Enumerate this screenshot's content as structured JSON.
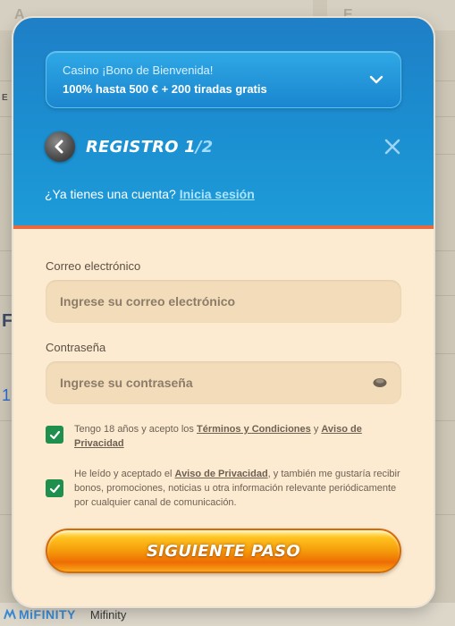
{
  "background": {
    "title_fragment_1": "A",
    "title_fragment_2": "E",
    "letter_1": "F",
    "letter_2": "1",
    "letter_3": "E",
    "footer_brand_logo": "MiFINITY",
    "footer_brand_name": "Mifinity"
  },
  "bonus": {
    "title": "Casino ¡Bono de Bienvenida!",
    "offer": "100% hasta 500 € + 200 tiradas gratis"
  },
  "header": {
    "step_title": "REGISTRO 1",
    "step_separator": "/",
    "step_total": "2",
    "account_question": "¿Ya tienes una cuenta?",
    "login_link": "Inicia sesión"
  },
  "form": {
    "email_label": "Correo electrónico",
    "email_placeholder": "Ingrese su correo electrónico",
    "email_value": "",
    "password_label": "Contraseña",
    "password_placeholder": "Ingrese su contraseña",
    "password_value": ""
  },
  "consents": {
    "age_text_1": "Tengo 18 años y acepto los",
    "age_terms_link": "Términos y Condiciones",
    "age_text_2": "y",
    "age_privacy_link": "Aviso de Privacidad",
    "marketing_text_1": "He leído y aceptado el",
    "marketing_privacy_link": "Aviso de Privacidad",
    "marketing_text_2": ", y también me gustaría recibir bonos, promociones, noticias u otra información relevante periódicamente por cualquier canal de comunicación."
  },
  "actions": {
    "next_label": "SIGUIENTE PASO"
  },
  "colors": {
    "header_blue": "#1b8fd1",
    "accent_orange": "#e9683c",
    "checkbox_green": "#1e8f4c",
    "body_cream": "#fdebd1"
  }
}
